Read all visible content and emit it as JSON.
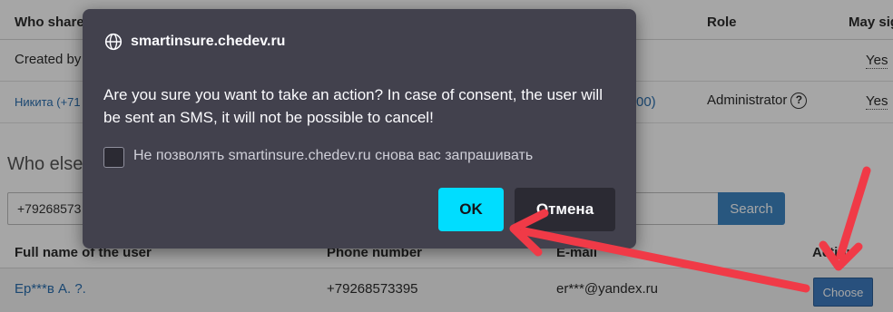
{
  "table": {
    "headers": {
      "who_shared": "Who share",
      "role": "Role",
      "may_sign": "May sig"
    },
    "rows": [
      {
        "who": "Created by",
        "role": "",
        "may_sign": "Yes"
      },
      {
        "who": "Никита (+71",
        "phone_tail": "00)",
        "role": "Administrator",
        "may_sign": "Yes"
      }
    ]
  },
  "section_title": "Who else",
  "search": {
    "value": "+79268573",
    "button_label": "Search"
  },
  "results": {
    "headers": {
      "full_name": "Full name of the user",
      "phone": "Phone number",
      "email": "E-mail",
      "action": "Action"
    },
    "rows": [
      {
        "name": "Ер***в А. ?.",
        "phone": "+79268573395",
        "email": "er***@yandex.ru",
        "action_label": "Choose"
      }
    ]
  },
  "dialog": {
    "title": "smartinsure.chedev.ru",
    "message": "Are you sure you want to take an action? In case of consent, the user will be sent an SMS, it will not be possible to cancel!",
    "checkbox_label": "Не позволять smartinsure.chedev.ru снова вас запрашивать",
    "ok_label": "OK",
    "cancel_label": "Отмена"
  },
  "colors": {
    "dialog_bg": "#42414d",
    "ok_button": "#00ddff",
    "annotation_arrow": "#f03a47",
    "link": "#2a6fb0",
    "primary_button": "#3e86c3"
  },
  "icons": {
    "dialog_icon": "globe-icon",
    "help_icon": "question-circle-icon"
  }
}
